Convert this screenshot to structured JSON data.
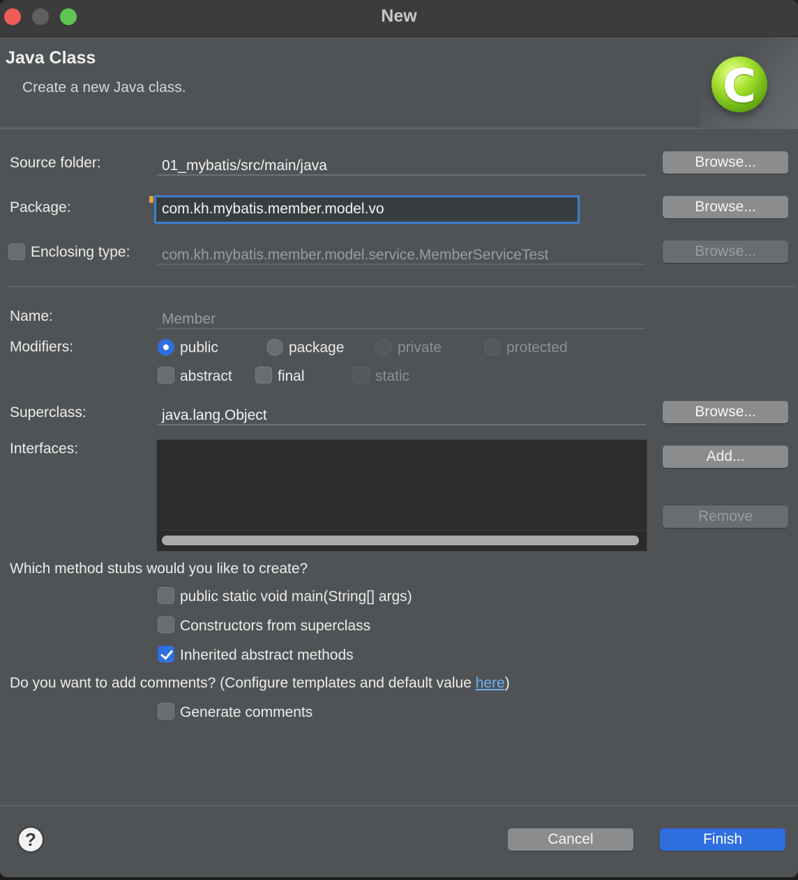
{
  "window": {
    "title": "New"
  },
  "header": {
    "title": "Java Class",
    "subtitle": "Create a new Java class.",
    "icon": "java-class-c-icon"
  },
  "source_folder": {
    "label": "Source folder:",
    "value": "01_mybatis/src/main/java",
    "browse": "Browse..."
  },
  "package": {
    "label": "Package:",
    "value": "com.kh.mybatis.member.model.vo",
    "browse": "Browse..."
  },
  "enclosing": {
    "label": "Enclosing type:",
    "value": "com.kh.mybatis.member.model.service.MemberServiceTest",
    "browse": "Browse...",
    "checked": false
  },
  "name": {
    "label": "Name:",
    "placeholder": "Member"
  },
  "modifiers": {
    "label": "Modifiers:",
    "access": [
      "public",
      "package",
      "private",
      "protected"
    ],
    "selected": "public",
    "flags": [
      "abstract",
      "final",
      "static"
    ]
  },
  "superclass": {
    "label": "Superclass:",
    "value": "java.lang.Object",
    "browse": "Browse..."
  },
  "interfaces": {
    "label": "Interfaces:",
    "add": "Add...",
    "remove": "Remove"
  },
  "stubs": {
    "question": "Which method stubs would you like to create?",
    "options": [
      {
        "label": "public static void main(String[] args)",
        "checked": false
      },
      {
        "label": "Constructors from superclass",
        "checked": false
      },
      {
        "label": "Inherited abstract methods",
        "checked": true
      }
    ]
  },
  "comments": {
    "question_prefix": "Do you want to add comments? (Configure templates and default value ",
    "link": "here",
    "question_suffix": ")",
    "option": "Generate comments",
    "checked": false
  },
  "footer": {
    "help": "?",
    "cancel": "Cancel",
    "finish": "Finish"
  },
  "colors": {
    "accent": "#2f6fe0",
    "background": "#505355",
    "focus_border": "#3d7fd0"
  }
}
